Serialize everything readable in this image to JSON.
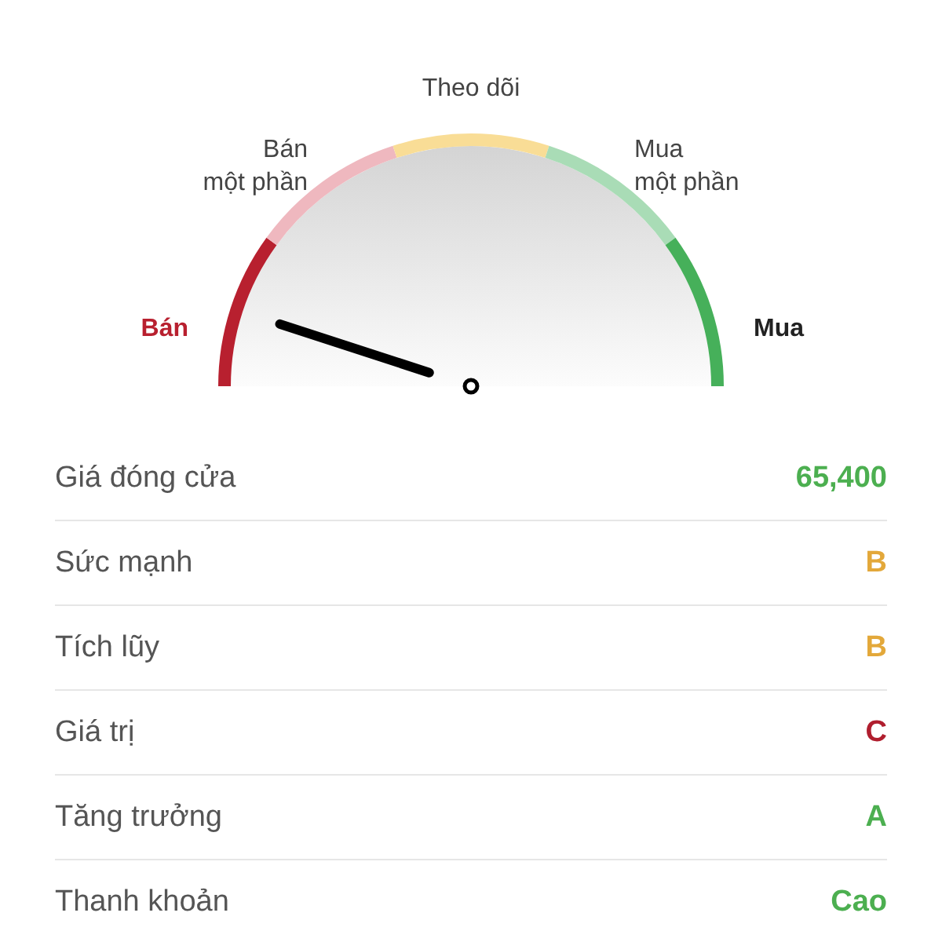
{
  "gauge": {
    "zones": [
      {
        "label": "Bán",
        "kind": "sell",
        "color": "#b8202f"
      },
      {
        "label": "Bán\nmột phần",
        "kind": "partial",
        "color": "#efb8bf"
      },
      {
        "label": "Theo dõi",
        "kind": "hold",
        "color": "#f9dd96"
      },
      {
        "label": "Mua\nmột phần",
        "kind": "partial",
        "color": "#a9dcb6"
      },
      {
        "label": "Mua",
        "kind": "buy",
        "color": "#46b05a"
      }
    ],
    "level": 0.1
  },
  "rows": [
    {
      "label": "Giá đóng cửa",
      "value": "65,400",
      "color": "#4caf50"
    },
    {
      "label": "Sức mạnh",
      "value": "B",
      "color": "#e3a83a"
    },
    {
      "label": "Tích lũy",
      "value": "B",
      "color": "#e3a83a"
    },
    {
      "label": "Giá trị",
      "value": "C",
      "color": "#b01e2e"
    },
    {
      "label": "Tăng trưởng",
      "value": "A",
      "color": "#4caf50"
    },
    {
      "label": "Thanh khoản",
      "value": "Cao",
      "color": "#4caf50"
    }
  ]
}
